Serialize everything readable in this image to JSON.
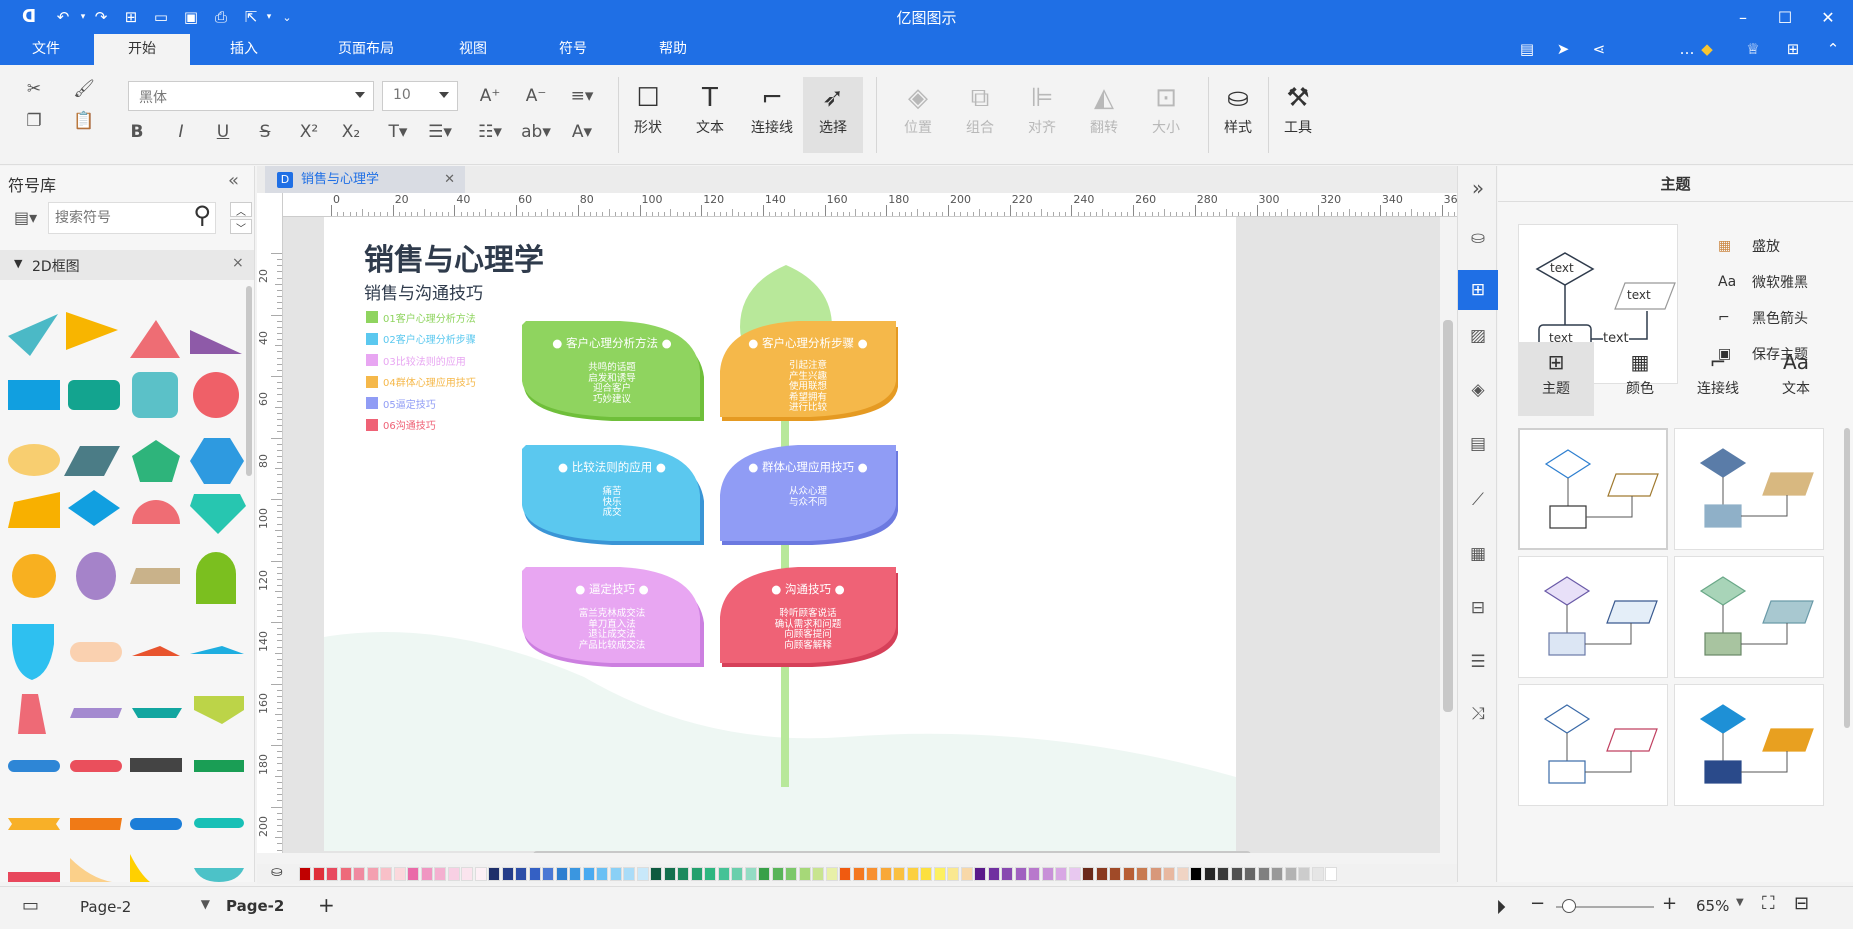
{
  "app": {
    "title": "亿图图示"
  },
  "menus": {
    "file": "文件",
    "home": "开始",
    "insert": "插入",
    "layout": "页面布局",
    "view": "视图",
    "symbol": "符号",
    "help": "帮助"
  },
  "ribbon": {
    "font": "黑体",
    "size": "10",
    "shape": "形状",
    "text": "文本",
    "connector": "连接线",
    "select": "选择",
    "position": "位置",
    "group": "组合",
    "align": "对齐",
    "flip": "翻转",
    "size_label": "大小",
    "style": "样式",
    "tools": "工具"
  },
  "library": {
    "title": "符号库",
    "search_placeholder": "搜索符号",
    "category": "2D框图"
  },
  "document": {
    "tab": "销售与心理学"
  },
  "ruler": {
    "h": [
      "0",
      "20",
      "40",
      "60",
      "80",
      "100",
      "120",
      "140",
      "160",
      "180",
      "200",
      "220",
      "240",
      "260",
      "280",
      "300",
      "320",
      "340",
      "36"
    ],
    "v": [
      "20",
      "40",
      "60",
      "80",
      "100",
      "120",
      "140",
      "160",
      "180",
      "200"
    ]
  },
  "diagram": {
    "title": "销售与心理学",
    "subtitle": "销售与沟通技巧",
    "legend": [
      {
        "label": "01客户心理分析方法",
        "color": "#8fd45f"
      },
      {
        "label": "02客户心理分析步骤",
        "color": "#5bc8ef"
      },
      {
        "label": "03比较法则的应用",
        "color": "#e8a6f2"
      },
      {
        "label": "04群体心理应用技巧",
        "color": "#f5b84a"
      },
      {
        "label": "05逼定技巧",
        "color": "#909cf5"
      },
      {
        "label": "06沟通技巧",
        "color": "#ef6276"
      }
    ],
    "leaves": [
      {
        "title": "客户心理分析方法",
        "body": [
          "共鸣的话题",
          "启发和诱导",
          "迎合客户",
          "巧妙建议"
        ],
        "color": "#8fd45f",
        "shade": "#6fbf3a"
      },
      {
        "title": "客户心理分析步骤",
        "body": [
          "引起注意",
          "产生兴趣",
          "使用联想",
          "希望拥有",
          "进行比较"
        ],
        "color": "#f5b84a",
        "shade": "#e59a22"
      },
      {
        "title": "比较法则的应用",
        "body": [
          "痛苦",
          "快乐",
          "成交"
        ],
        "color": "#5bc8ef",
        "shade": "#3a95d6"
      },
      {
        "title": "群体心理应用技巧",
        "body": [
          "从众心理",
          "与众不同"
        ],
        "color": "#909cf5",
        "shade": "#6c79e0"
      },
      {
        "title": "逼定技巧",
        "body": [
          "富兰克林成交法",
          "单刀直入法",
          "退让成交法",
          "产品比较成交法"
        ],
        "color": "#e8a6f2",
        "shade": "#cc7fe0"
      },
      {
        "title": "沟通技巧",
        "body": [
          "聆听顾客说话",
          "确认需求和问题",
          "向顾客提问",
          "向顾客解释"
        ],
        "color": "#ef6276",
        "shade": "#d64059"
      }
    ]
  },
  "theme_panel": {
    "title": "主题",
    "preview_text": "text",
    "options": [
      "盛放",
      "微软雅黑",
      "黑色箭头",
      "保存主题"
    ],
    "tabs": [
      "主题",
      "颜色",
      "连接线",
      "文本"
    ]
  },
  "status": {
    "page_select": "Page-2",
    "page_tab": "Page-2",
    "add": "+",
    "zoom": "65%"
  },
  "palette": [
    "#c00000",
    "#e0303a",
    "#e84a5f",
    "#ee6a7a",
    "#f08aa0",
    "#f4a0b0",
    "#f8c0c8",
    "#fbd8dc",
    "#ea6aa8",
    "#f096c2",
    "#f4b0d0",
    "#f8d0e4",
    "#fbe4ee",
    "#fdf0f6",
    "#1e2f6a",
    "#243d8a",
    "#2c4ea8",
    "#3460c4",
    "#4a78d4",
    "#2e7fd0",
    "#3a96e0",
    "#4aaaf0",
    "#6ac0f4",
    "#8ad0f6",
    "#aadcf8",
    "#c8e8fa",
    "#0e5a40",
    "#14704e",
    "#1c8a5e",
    "#24a06e",
    "#2eb680",
    "#46c296",
    "#6acfac",
    "#94dcc4",
    "#38a048",
    "#58b458",
    "#7cc86a",
    "#a6d878",
    "#c8e490",
    "#e8f0a8",
    "#f05a10",
    "#f47820",
    "#f89030",
    "#f8a838",
    "#fac040",
    "#fcd040",
    "#fce040",
    "#fdf060",
    "#fae890",
    "#f8d8a8",
    "#5a1a8a",
    "#7030a0",
    "#8848b0",
    "#a060c0",
    "#b878cc",
    "#c890d8",
    "#d8a8e4",
    "#e8c8f0",
    "#6a2a1a",
    "#8a3a20",
    "#a04a28",
    "#b85e34",
    "#c87a50",
    "#d8987a",
    "#e8b8a0",
    "#f0d4c4",
    "#000000",
    "#262626",
    "#3a3a3a",
    "#505050",
    "#666666",
    "#808080",
    "#999999",
    "#b3b3b3",
    "#cccccc",
    "#e6e6e6",
    "#ffffff"
  ]
}
